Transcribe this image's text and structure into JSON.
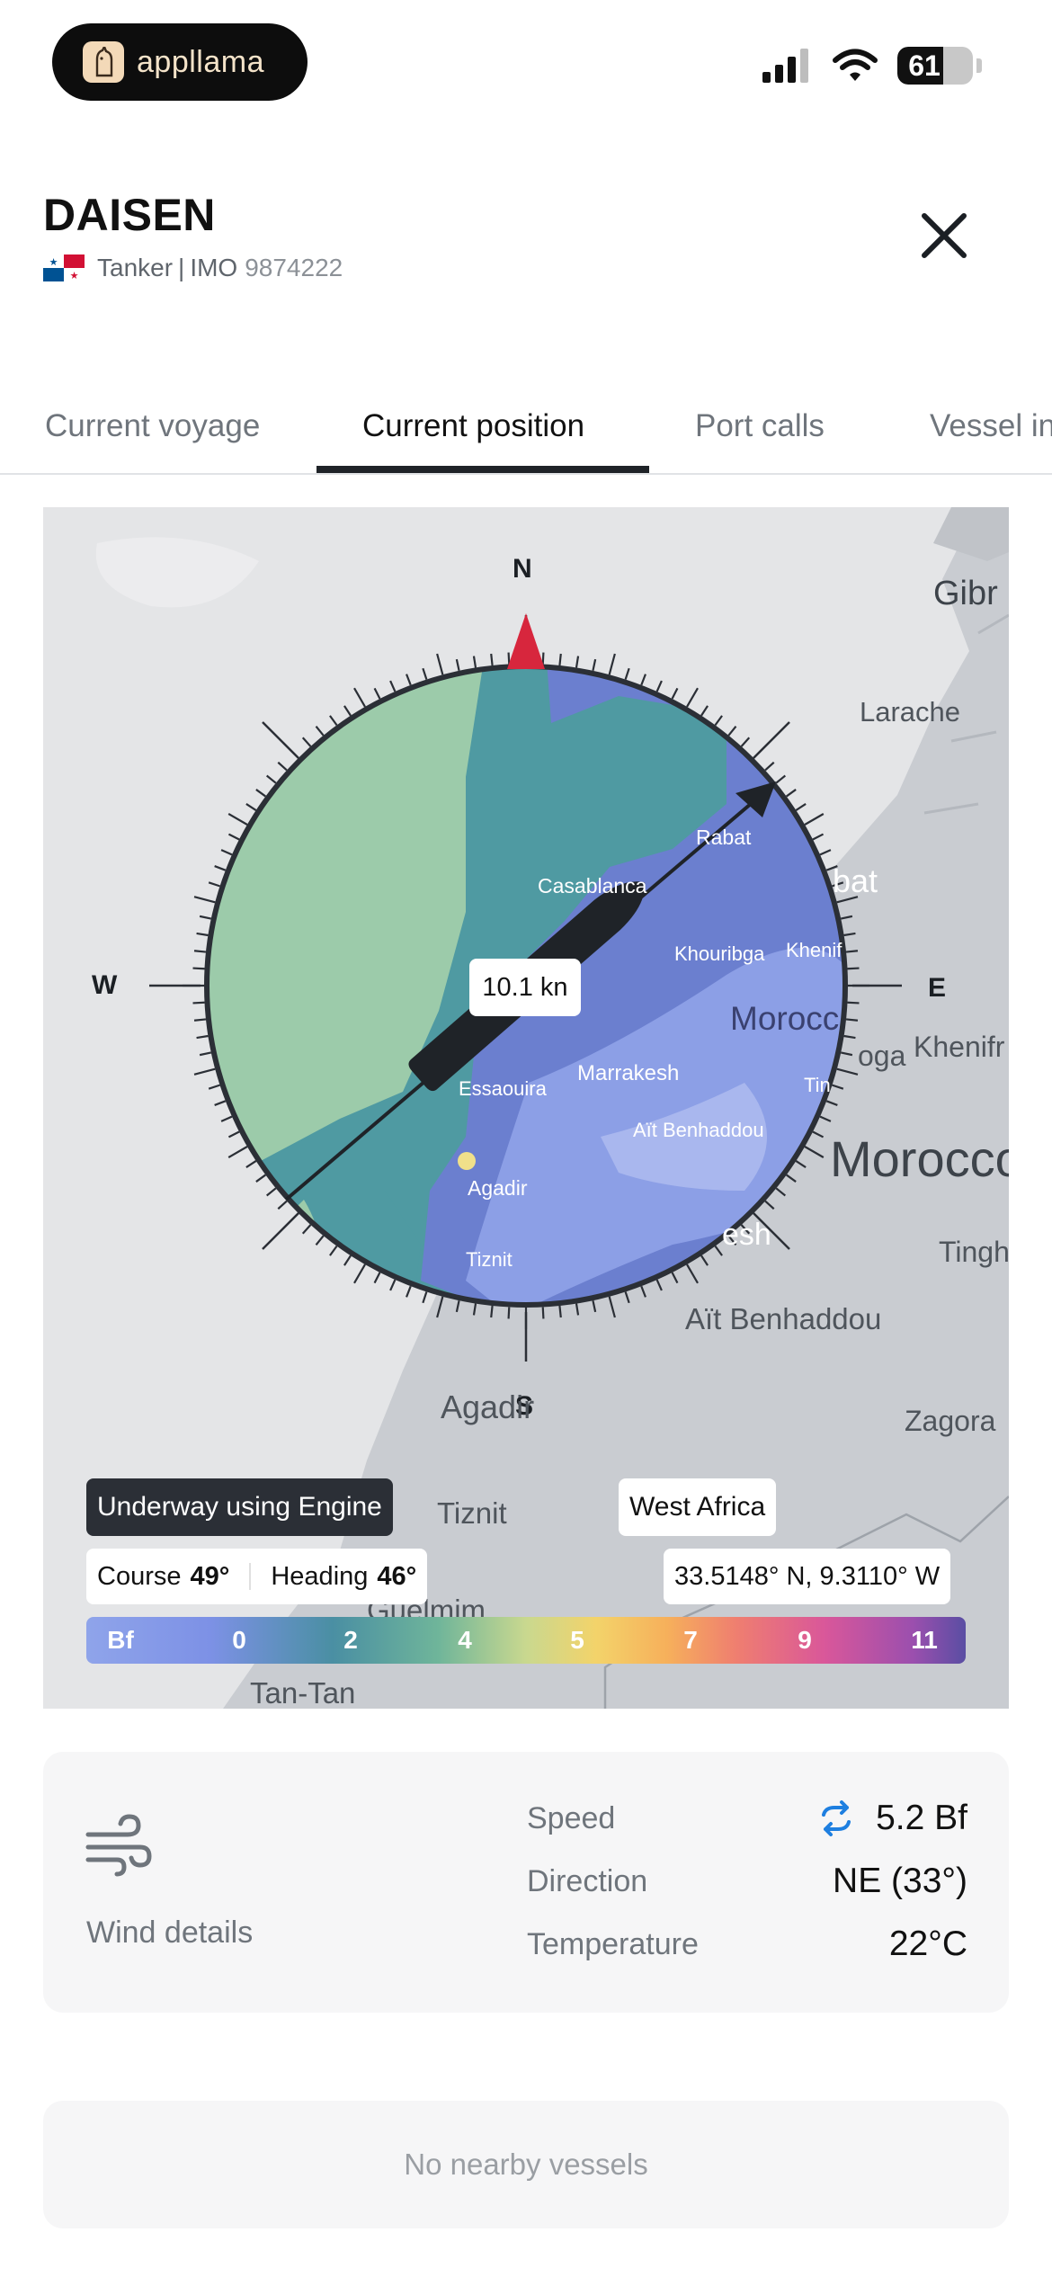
{
  "status_bar": {
    "app_name": "appllama",
    "battery": "61",
    "battery_level": 0.61
  },
  "vessel": {
    "name": "DAISEN",
    "type": "Tanker",
    "separator": "|",
    "imo_label": "IMO",
    "imo": "9874222"
  },
  "tabs": [
    {
      "label": "Current voyage",
      "active": false
    },
    {
      "label": "Current position",
      "active": true
    },
    {
      "label": "Port calls",
      "active": false
    },
    {
      "label": "Vessel in",
      "active": false
    }
  ],
  "map": {
    "compass": {
      "n": "N",
      "s": "S",
      "e": "E",
      "w": "W"
    },
    "speed": "10.1 kn",
    "places": [
      "Gibr",
      "Larache",
      "Rabat",
      "Casablanca",
      "bat",
      "Khouribga",
      "Khenif",
      "Morocc",
      "oga",
      "Khenifr",
      "Essaouira",
      "Marrakesh",
      "Tin",
      "Aït Benhaddou",
      "Morocco",
      "Agadir",
      "esh",
      "Tinghi",
      "Tiznit",
      "Aït Benhaddou",
      "Agadir",
      "Zagora",
      "Tiznit",
      "Guelmim",
      "Tan-Tan"
    ],
    "status": "Underway using Engine",
    "region": "West Africa",
    "course_label": "Course",
    "course": "49°",
    "heading_label": "Heading",
    "heading": "46°",
    "coordinates": "33.5148° N, 9.3110° W",
    "bf_scale": [
      "Bf",
      "0",
      "2",
      "4",
      "5",
      "7",
      "9",
      "11"
    ]
  },
  "wind": {
    "title": "Wind details",
    "rows": [
      {
        "label": "Speed",
        "value": "5.2 Bf"
      },
      {
        "label": "Direction",
        "value": "NE (33°)"
      },
      {
        "label": "Temperature",
        "value": "22°C"
      }
    ]
  },
  "nearby": {
    "empty_text": "No nearby vessels"
  },
  "colors": {
    "accent": "#1f2328",
    "compass_north": "#d7263d",
    "sync": "#1e7fe0"
  }
}
